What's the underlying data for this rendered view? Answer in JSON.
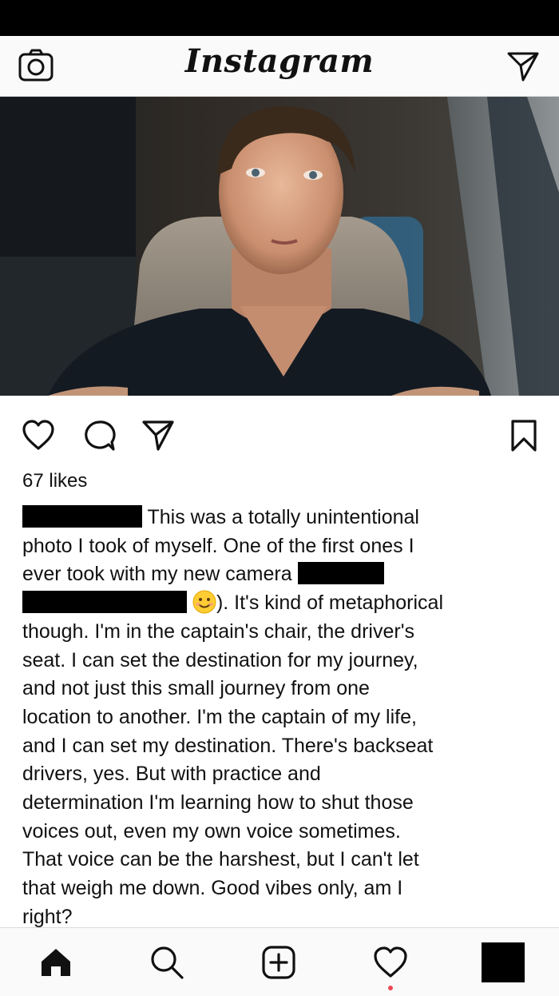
{
  "header": {
    "logo_text": "Instagram",
    "camera_icon": "camera-icon",
    "direct_icon": "paper-plane-icon"
  },
  "post": {
    "image_description_icon": "car-selfie-photo",
    "actions": {
      "like_icon": "heart-icon",
      "comment_icon": "comment-icon",
      "share_icon": "paper-plane-icon",
      "save_icon": "bookmark-icon"
    },
    "likes": "67 likes",
    "caption": {
      "line1": "This was a totally unintentional",
      "line2": "photo I took of myself. One of the first ones I",
      "line3": "ever took with my new camera",
      "line4": "). It's kind of metaphorical",
      "line5": "though. I'm in the captain's chair, the driver's",
      "line6": "seat. I can set the destination for my journey,",
      "line7": "and not just this small journey from one",
      "line8": "location to another. I'm the captain of my life,",
      "line9": "and I can set my destination. There's backseat",
      "line10": "drivers, yes. But with practice and",
      "line11": "determination I'm learning how to shut those",
      "line12": "voices out, even my own voice sometimes.",
      "line13": "That voice can be the harshest, but I can't let",
      "line14": "that weigh me down. Good vibes only, am I",
      "line15": "right?"
    }
  },
  "bottom_nav": {
    "tabs": [
      "home-icon",
      "search-icon",
      "add-post-icon",
      "activity-heart-icon",
      "profile-avatar"
    ]
  },
  "colors": {
    "background": "#ffffff",
    "bar_background": "#fafafa",
    "notification_dot": "#ed4956",
    "redaction": "#000000"
  }
}
